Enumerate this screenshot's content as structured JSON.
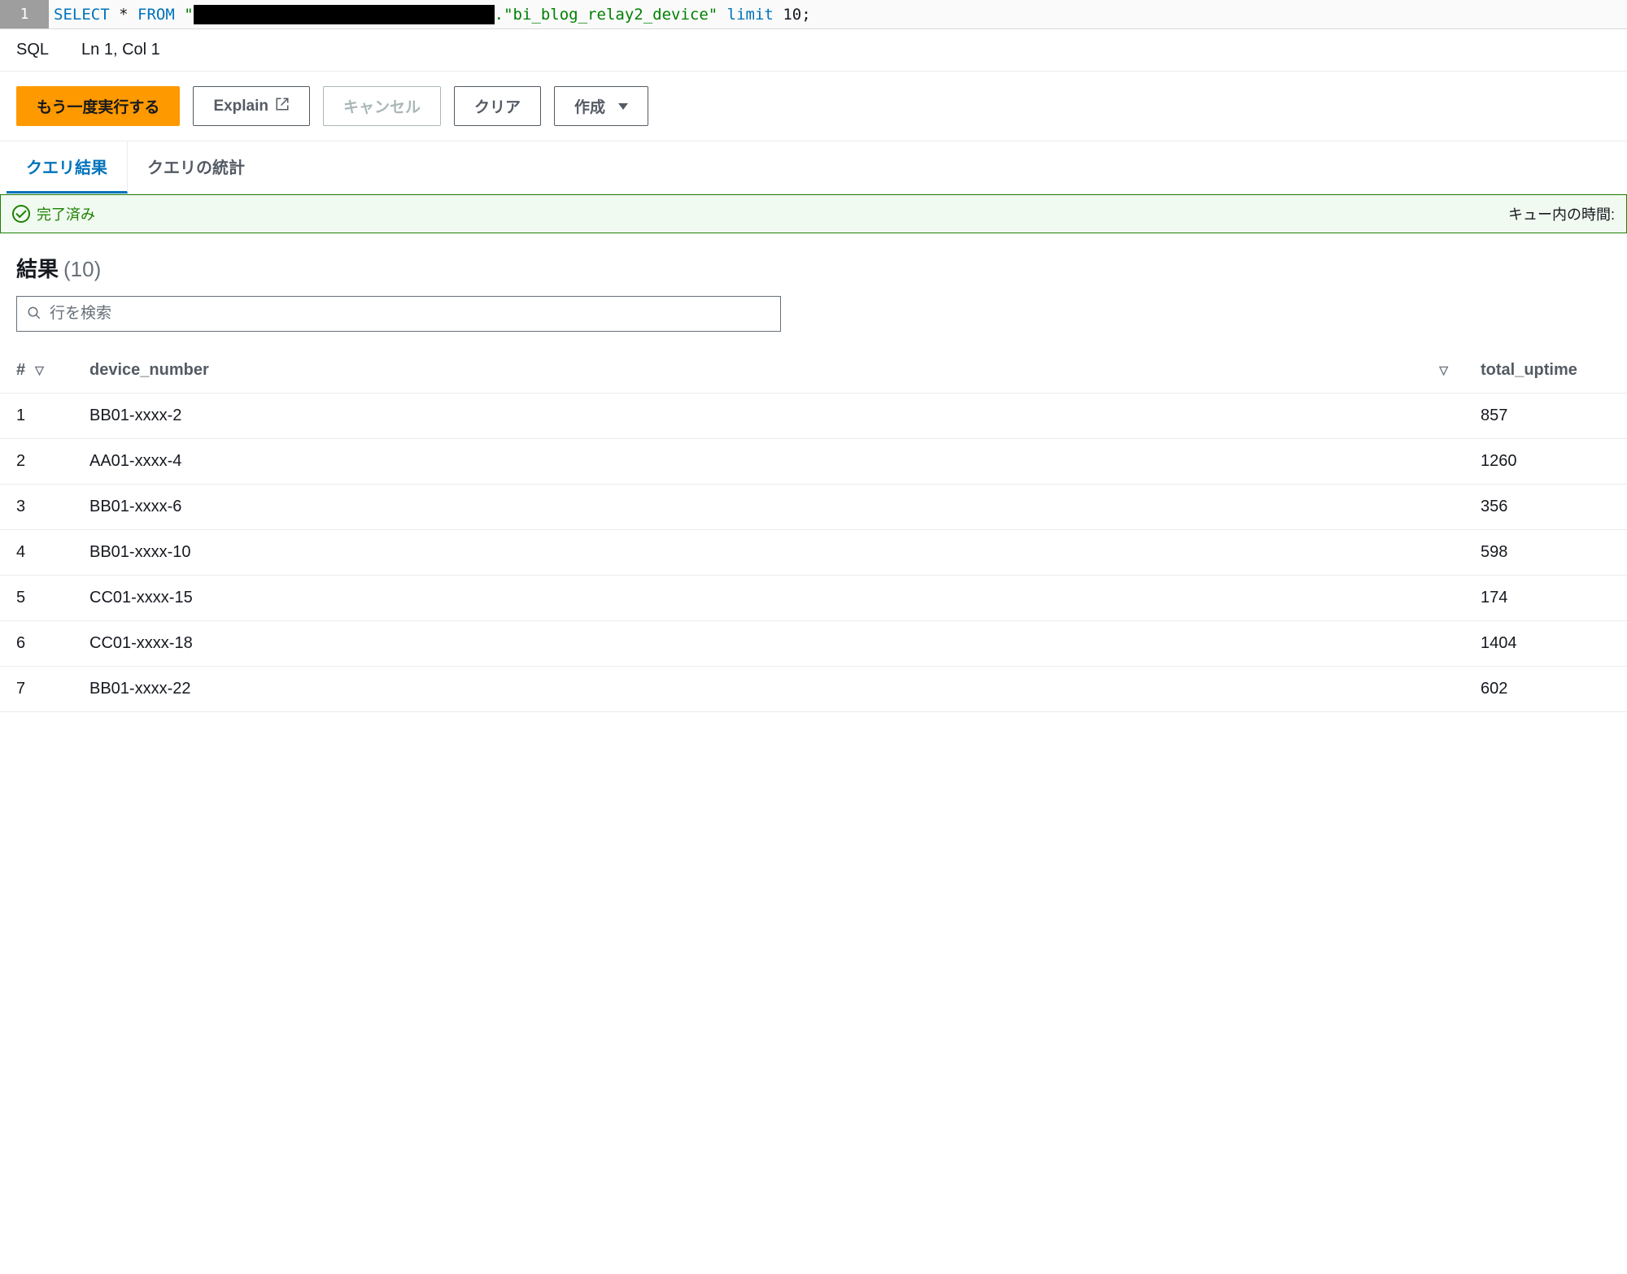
{
  "editor": {
    "line_number": "1",
    "sql_select": "SELECT",
    "sql_star": "*",
    "sql_from": "FROM",
    "sql_quote1": "\"",
    "sql_table_suffix": ".\"bi_blog_relay2_device\"",
    "sql_limit": "limit",
    "sql_num": "10",
    "sql_semi": ";"
  },
  "status": {
    "language": "SQL",
    "cursor": "Ln 1, Col 1"
  },
  "buttons": {
    "run_again": "もう一度実行する",
    "explain": "Explain",
    "cancel": "キャンセル",
    "clear": "クリア",
    "create": "作成"
  },
  "tabs": {
    "results": "クエリ結果",
    "stats": "クエリの統計"
  },
  "banner": {
    "completed": "完了済み",
    "queue_time_label": "キュー内の時間:"
  },
  "results": {
    "heading": "結果",
    "count": "(10)"
  },
  "search": {
    "placeholder": "行を検索"
  },
  "table": {
    "headers": {
      "index": "#",
      "device_number": "device_number",
      "total_uptime": "total_uptime"
    },
    "rows": [
      {
        "idx": "1",
        "device_number": "BB01-xxxx-2",
        "total_uptime": "857"
      },
      {
        "idx": "2",
        "device_number": "AA01-xxxx-4",
        "total_uptime": "1260"
      },
      {
        "idx": "3",
        "device_number": "BB01-xxxx-6",
        "total_uptime": "356"
      },
      {
        "idx": "4",
        "device_number": "BB01-xxxx-10",
        "total_uptime": "598"
      },
      {
        "idx": "5",
        "device_number": "CC01-xxxx-15",
        "total_uptime": "174"
      },
      {
        "idx": "6",
        "device_number": "CC01-xxxx-18",
        "total_uptime": "1404"
      },
      {
        "idx": "7",
        "device_number": "BB01-xxxx-22",
        "total_uptime": "602"
      }
    ]
  }
}
